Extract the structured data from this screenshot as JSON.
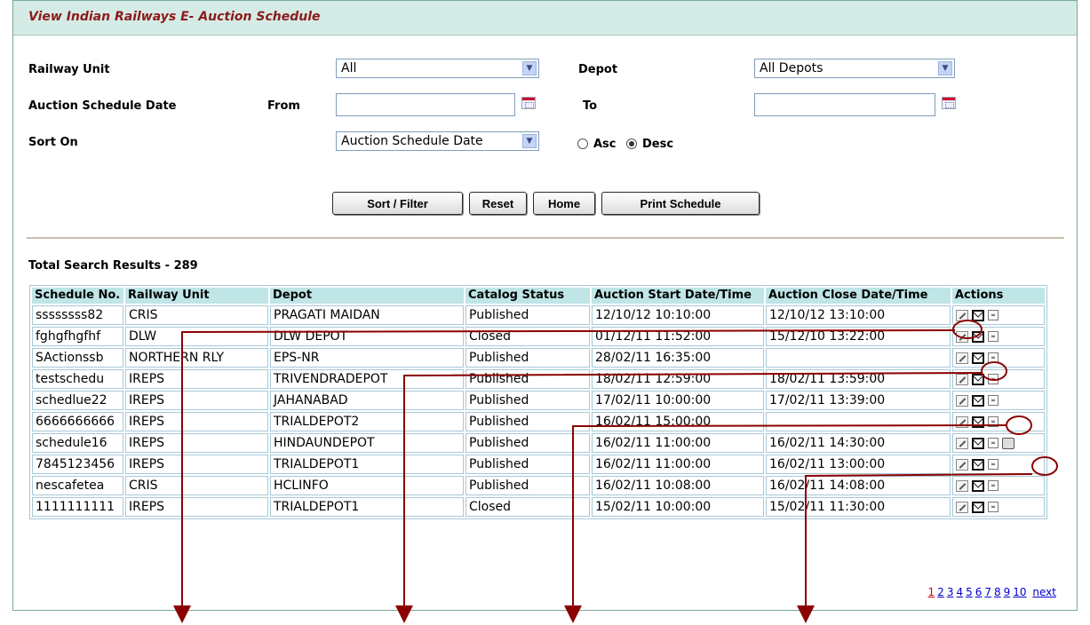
{
  "header": {
    "title": "View Indian Railways E- Auction Schedule"
  },
  "filters": {
    "railway_unit_label": "Railway Unit",
    "railway_unit_value": "All",
    "depot_label": "Depot",
    "depot_value": "All Depots",
    "schedule_date_label": "Auction Schedule Date",
    "from_label": "From",
    "from_value": "",
    "to_label": "To",
    "to_value": "",
    "sort_on_label": "Sort On",
    "sort_on_value": "Auction Schedule Date",
    "asc_label": "Asc",
    "desc_label": "Desc",
    "sort_order_selected": "Desc"
  },
  "buttons": {
    "sort_filter": "Sort / Filter",
    "reset": "Reset",
    "home": "Home",
    "print": "Print Schedule"
  },
  "results": {
    "total_label": "Total Search Results - 289",
    "columns": [
      "Schedule No.",
      "Railway Unit",
      "Depot",
      "Catalog Status",
      "Auction Start Date/Time",
      "Auction Close Date/Time",
      "Actions"
    ],
    "rows": [
      [
        "ssssssss82",
        "CRIS",
        "PRAGATI MAIDAN",
        "Published",
        "12/10/12 10:10:00",
        "12/10/12 13:10:00"
      ],
      [
        "fghgfhgfhf",
        "DLW",
        "DLW DEPOT",
        "Closed",
        "01/12/11 11:52:00",
        "15/12/10 13:22:00"
      ],
      [
        "SActionssb",
        "NORTHERN RLY",
        "EPS-NR",
        "Published",
        "28/02/11 16:35:00",
        ""
      ],
      [
        "testschedu",
        "IREPS",
        "TRIVENDRADEPOT",
        "Published",
        "18/02/11 12:59:00",
        "18/02/11 13:59:00"
      ],
      [
        "schedlue22",
        "IREPS",
        "JAHANABAD",
        "Published",
        "17/02/11 10:00:00",
        "17/02/11 13:39:00"
      ],
      [
        "6666666666",
        "IREPS",
        "TRIALDEPOT2",
        "Published",
        "16/02/11 15:00:00",
        ""
      ],
      [
        "schedule16",
        "IREPS",
        "HINDAUNDEPOT",
        "Published",
        "16/02/11 11:00:00",
        "16/02/11 14:30:00"
      ],
      [
        "7845123456",
        "IREPS",
        "TRIALDEPOT1",
        "Published",
        "16/02/11 11:00:00",
        "16/02/11 13:00:00"
      ],
      [
        "nescafetea",
        "CRIS",
        "HCLINFO",
        "Published",
        "16/02/11 10:08:00",
        "16/02/11 14:08:00"
      ],
      [
        "1111111111",
        "IREPS",
        "TRIALDEPOT1",
        "Closed",
        "15/02/11 10:00:00",
        "15/02/11 11:30:00"
      ]
    ],
    "row_icons": [
      [
        "edit-icon",
        "mail-icon",
        "view-icon"
      ],
      [
        "edit-icon",
        "mail-icon",
        "view-icon"
      ],
      [
        "edit-icon",
        "mail-icon",
        "view-icon"
      ],
      [
        "edit-icon",
        "mail-icon",
        "view-icon"
      ],
      [
        "edit-icon",
        "mail-icon",
        "view-icon"
      ],
      [
        "edit-icon",
        "mail-icon",
        "view-icon"
      ],
      [
        "edit-icon",
        "mail-icon",
        "view-icon",
        "book-icon"
      ],
      [
        "edit-icon",
        "mail-icon",
        "view-icon"
      ],
      [
        "edit-icon",
        "mail-icon",
        "view-icon"
      ],
      [
        "edit-icon",
        "mail-icon",
        "view-icon"
      ]
    ]
  },
  "pagination": {
    "pages": [
      "1",
      "2",
      "3",
      "4",
      "5",
      "6",
      "7",
      "8",
      "9",
      "10"
    ],
    "current": "1",
    "next_label": "next"
  },
  "colors": {
    "header_bg": "#d5ebe6",
    "title_color": "#8b1a1a",
    "table_header_bg": "#bfe5e6",
    "annotation_color": "#8b0000"
  }
}
